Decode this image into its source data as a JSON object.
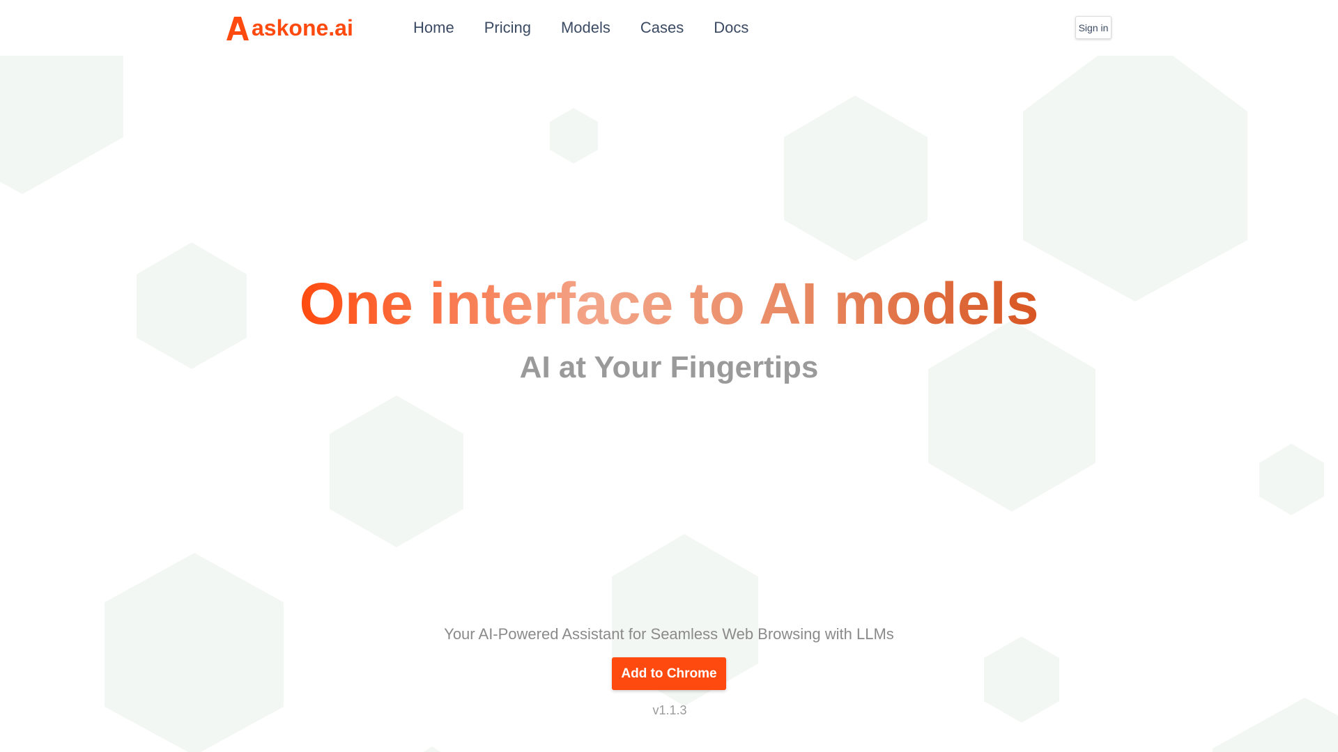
{
  "brand": {
    "name": "askone.ai",
    "accent_color": "#ff4a0f",
    "logo_icon": "askone-a-icon"
  },
  "nav": {
    "items": [
      {
        "label": "Home"
      },
      {
        "label": "Pricing"
      },
      {
        "label": "Models"
      },
      {
        "label": "Cases"
      },
      {
        "label": "Docs"
      }
    ],
    "signin_label": "Sign in"
  },
  "hero": {
    "title": "One interface to AI models",
    "subtitle": "AI at Your Fingertips",
    "tagline": "Your AI-Powered Assistant for Seamless Web Browsing with LLMs",
    "cta_label": "Add to Chrome",
    "version": "v1.1.3"
  },
  "colors": {
    "nav_text": "#3b4a63",
    "subtitle_text": "#9a9a9a",
    "hexagon_fill": "#f3f7f4"
  }
}
